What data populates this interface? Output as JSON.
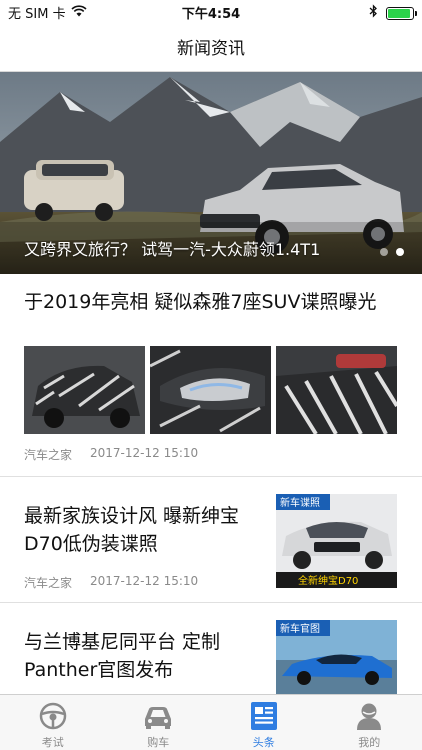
{
  "status_bar": {
    "carrier": "无 SIM 卡",
    "time": "下午4:54",
    "battery_level": 0.9,
    "battery_color": "#2bd24a",
    "icons": [
      "wifi-icon",
      "bluetooth-icon",
      "battery-icon"
    ]
  },
  "nav": {
    "title": "新闻资讯"
  },
  "banner": {
    "caption": "又跨界又旅行？ 试驾一汽-大众蔚领1.4T1",
    "page_count": 2,
    "active_page": 2
  },
  "articles": [
    {
      "title": "于2019年亮相 疑似森雅7座SUV谍照曝光",
      "source": "汽车之家",
      "time": "2017-12-12 15:10",
      "image_count": 3
    },
    {
      "title": "最新家族设计风 曝新绅宝D70低伪装谍照",
      "source": "汽车之家",
      "time": "2017-12-12 15:10",
      "image_badge": "新车谍照",
      "image_caption": "全新绅宝D70"
    },
    {
      "title": "与兰博基尼同平台 定制Panther官图发布",
      "image_badge": "新车官图"
    }
  ],
  "tabs": [
    {
      "label": "考试",
      "icon": "steering-wheel-icon",
      "active": false
    },
    {
      "label": "购车",
      "icon": "car-icon",
      "active": false
    },
    {
      "label": "头条",
      "icon": "news-icon",
      "active": true
    },
    {
      "label": "我的",
      "icon": "user-icon",
      "active": false
    }
  ],
  "colors": {
    "accent": "#2f7de1",
    "tab_inactive": "#8a8a8a",
    "badge": "#1a5fb4"
  }
}
